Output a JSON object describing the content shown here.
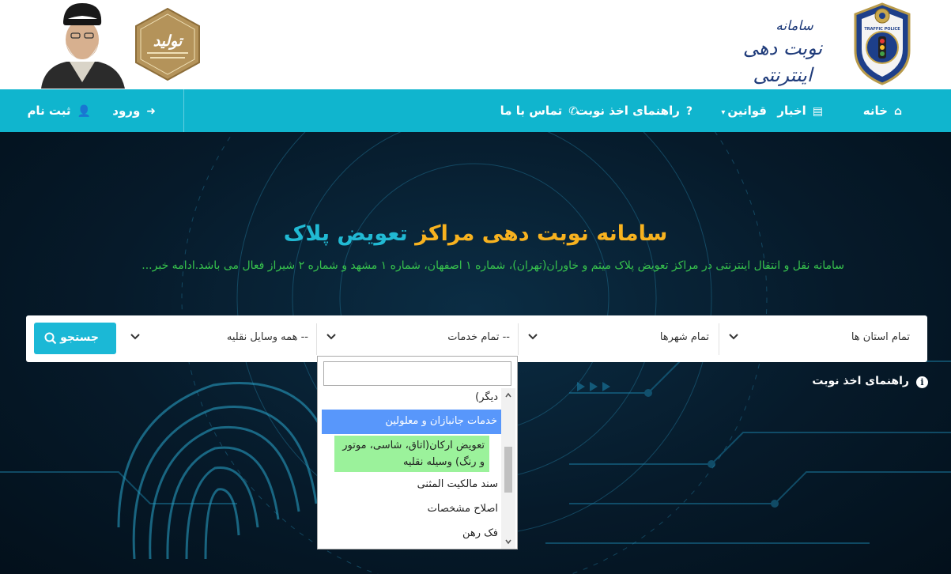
{
  "header": {
    "logo_line1": "سامانه",
    "logo_line2": "نوبت دهی اینترنتی",
    "badge_name": "traffic-police-badge",
    "badge_text": "TRAFFIC POLICE",
    "emblem_text": "تولید"
  },
  "nav": {
    "items": [
      {
        "label": "خانه",
        "icon": "home-icon"
      },
      {
        "label": "اخبار",
        "icon": "news-icon"
      },
      {
        "label": "قوانین",
        "icon": "caret-down-icon"
      },
      {
        "label": "راهنمای اخذ نوبت",
        "icon": "question-icon"
      },
      {
        "label": "تماس با ما",
        "icon": "phone-icon"
      }
    ],
    "login_label": "ورود",
    "register_label": "ثبت نام"
  },
  "hero": {
    "title_part1": "سامانه نوبت دهی مراکز",
    "title_part2": "تعویض پلاک",
    "subtitle": "سامانه نقل و انتقال اینترنتی در مراکز تعویض پلاک میثم و خاوران(تهران)، شماره ۱ اصفهان، شماره ۱ مشهد و شماره ۲ شیراز فعال می باشد.ادامه خبر...",
    "colors": {
      "title_yellow": "#f7b21f",
      "title_cyan": "#21b9d3",
      "subtitle_green": "#37c34d"
    }
  },
  "search": {
    "province": "تمام استان ها",
    "city": "تمام شهرها",
    "service": "-- تمام خدمات",
    "vehicle": "-- همه وسایل نقلیه",
    "button_label": "جستجو"
  },
  "dropdown": {
    "search_value": "",
    "options": [
      "دیگر)",
      "خدمات جانبازان و معلولین",
      "تعویض ارکان(اتاق، شاسی، موتور و رنگ) وسیله نقلیه",
      "سند مالکیت المثنی",
      "اصلاح مشخصات",
      "فک رهن"
    ],
    "highlighted": "خدمات جانبازان و معلولین"
  },
  "help_link": "راهنمای اخذ نوبت",
  "colors": {
    "nav_bg": "#10b5ce",
    "button_bg": "#1bb8d6",
    "option_highlight": "#5897fb",
    "option_green": "#9bf29b"
  }
}
